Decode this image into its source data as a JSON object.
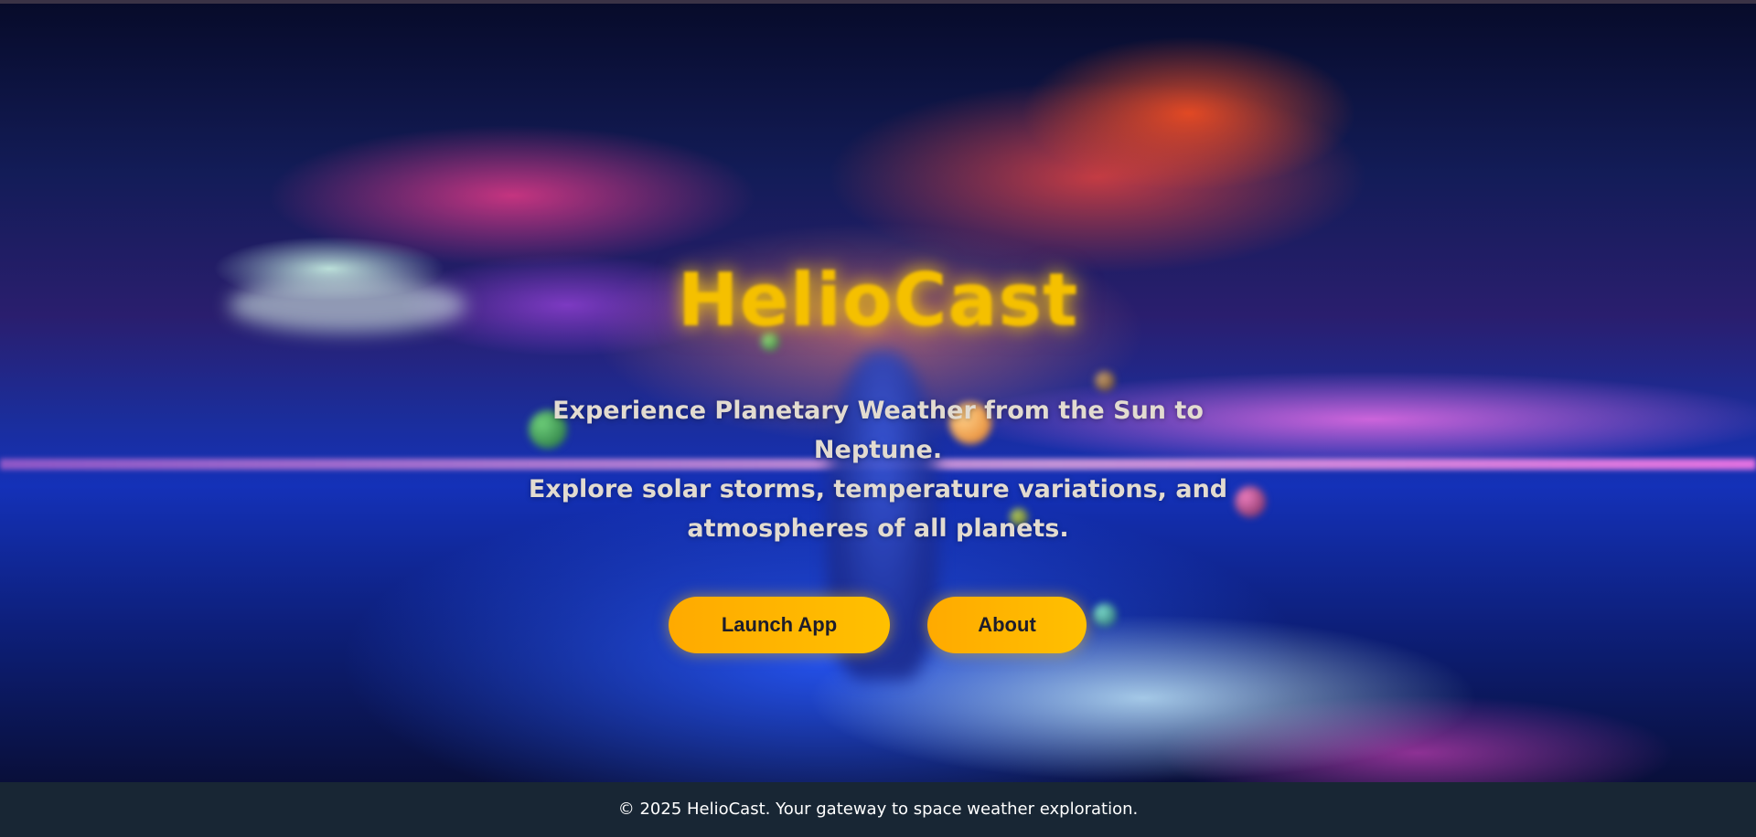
{
  "hero": {
    "title": "HelioCast",
    "tagline_line1": "Experience Planetary Weather from the Sun to Neptune.",
    "tagline_line2": "Explore solar storms, temperature variations, and atmospheres of all planets."
  },
  "actions": {
    "launch_label": "Launch App",
    "about_label": "About"
  },
  "footer": {
    "text": "© 2025 HelioCast. Your gateway to space weather exploration."
  },
  "colors": {
    "accent": "#ffb400",
    "title": "#f5c000",
    "footer_bg": "#182634",
    "subtitle": "#e2dbd0"
  }
}
